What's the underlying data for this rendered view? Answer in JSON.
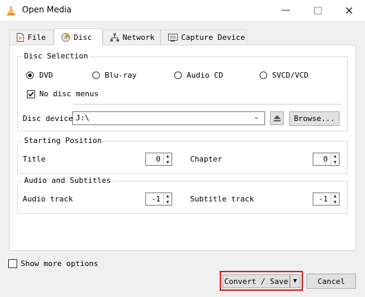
{
  "window": {
    "title": "Open Media",
    "minimize_glyph": "—",
    "close_glyph": "✕"
  },
  "tabs": [
    {
      "label": "File",
      "icon": "file-icon"
    },
    {
      "label": "Disc",
      "icon": "disc-icon"
    },
    {
      "label": "Network",
      "icon": "network-icon"
    },
    {
      "label": "Capture Device",
      "icon": "capture-device-icon"
    }
  ],
  "active_tab": "Disc",
  "disc_selection": {
    "title": "Disc Selection",
    "options": [
      {
        "label": "DVD",
        "checked": true
      },
      {
        "label": "Blu-ray",
        "checked": false
      },
      {
        "label": "Audio CD",
        "checked": false
      },
      {
        "label": "SVCD/VCD",
        "checked": false
      }
    ],
    "no_disc_menus": {
      "label": "No disc menus",
      "checked": true
    },
    "device_label": "Disc device",
    "device_value": "J:\\",
    "browse_label": "Browse..."
  },
  "starting_position": {
    "title": "Starting Position",
    "title_label": "Title",
    "title_value": "0",
    "chapter_label": "Chapter",
    "chapter_value": "0"
  },
  "audio_subtitles": {
    "title": "Audio and Subtitles",
    "audio_label": "Audio track",
    "audio_value": "-1",
    "subtitle_label": "Subtitle track",
    "subtitle_value": "-1"
  },
  "show_more": {
    "label": "Show more options",
    "checked": false
  },
  "buttons": {
    "convert": "Convert / Save",
    "cancel": "Cancel"
  },
  "colors": {
    "highlight": "#d32020",
    "vlc_orange": "#f28c1e"
  }
}
